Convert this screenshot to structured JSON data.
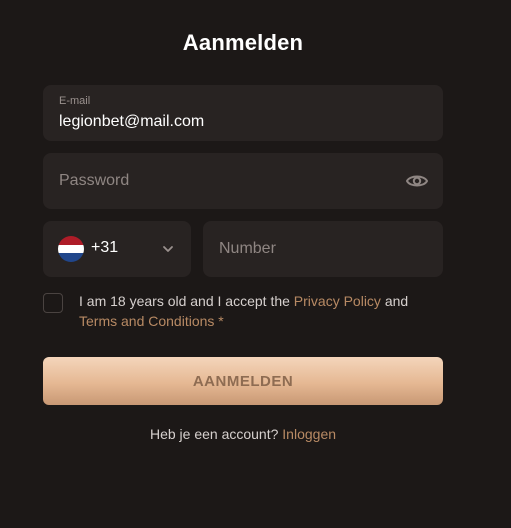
{
  "form": {
    "title": "Aanmelden",
    "email": {
      "label": "E-mail",
      "value": "legionbet@mail.com"
    },
    "password": {
      "placeholder": "Password",
      "toggle_icon": "eye-icon"
    },
    "phone": {
      "country_flag": "netherlands-flag-icon",
      "dial_code": "+31",
      "dropdown_icon": "chevron-down-icon",
      "number_placeholder": "Number"
    },
    "consent": {
      "text_before": "I am 18 years old and I accept the",
      "privacy_link": "Privacy Policy",
      "and": "and",
      "terms_link": "Terms and Conditions",
      "required_mark": "*",
      "checked": false
    },
    "submit_label": "AANMELDEN",
    "login_prompt": "Heb je een account?",
    "login_link": "Inloggen"
  },
  "colors": {
    "background": "#1c1817",
    "field_background": "#282322",
    "accent": "#b88a64",
    "button_gradient_top": "#f4d5bb",
    "button_gradient_bottom": "#c89874",
    "flag_red": "#ae1c28",
    "flag_white": "#ffffff",
    "flag_blue": "#21468b"
  }
}
